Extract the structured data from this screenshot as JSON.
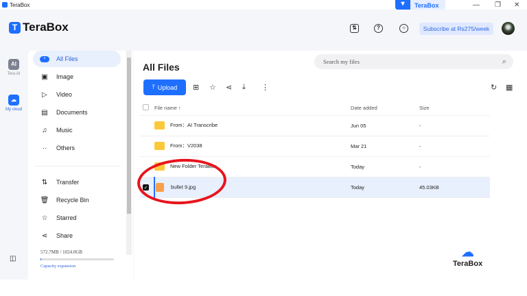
{
  "window": {
    "title": "TeraBox",
    "tab_label": "TeraBox"
  },
  "header": {
    "logo": "TeraBox",
    "subscribe": "Subscribe at Rs275/week",
    "icons": [
      "transfer-icon",
      "help-icon",
      "settings-icon"
    ]
  },
  "rail": [
    {
      "label": "Tera AI",
      "icon": "AI"
    },
    {
      "label": "My cloud",
      "icon": "☁"
    }
  ],
  "sidebar": {
    "items": [
      {
        "label": "All Files",
        "icon": "•"
      },
      {
        "label": "Image",
        "icon": "▣"
      },
      {
        "label": "Video",
        "icon": "▷"
      },
      {
        "label": "Documents",
        "icon": "▤"
      },
      {
        "label": "Music",
        "icon": "♫"
      },
      {
        "label": "Others",
        "icon": "··"
      }
    ],
    "items2": [
      {
        "label": "Transfer",
        "icon": "⇅"
      },
      {
        "label": "Recycle Bin",
        "icon": "🗑"
      },
      {
        "label": "Starred",
        "icon": "☆"
      },
      {
        "label": "Share",
        "icon": "⋖"
      }
    ],
    "storage": {
      "text": "572.7MB / 1024.0GB",
      "used_fraction": 0.0005,
      "link": "Capacity expansion"
    }
  },
  "main": {
    "title": "All Files",
    "search_placeholder": "Search my files",
    "upload": "Upload",
    "columns": [
      "File name",
      "Date added",
      "Size"
    ],
    "rows": [
      {
        "name": "From：AI Transcribe",
        "date": "Jun 05",
        "size": "-",
        "type": "folder",
        "selected": false
      },
      {
        "name": "From：V2038",
        "date": "Mar 21",
        "size": "-",
        "type": "folder",
        "selected": false
      },
      {
        "name": "New Folder TeraBox",
        "date": "Today",
        "size": "-",
        "type": "folder",
        "selected": false
      },
      {
        "name": "bullet 9.jpg",
        "date": "Today",
        "size": "45.03KB",
        "type": "image",
        "selected": true
      }
    ]
  },
  "watermark": "TeraBox"
}
